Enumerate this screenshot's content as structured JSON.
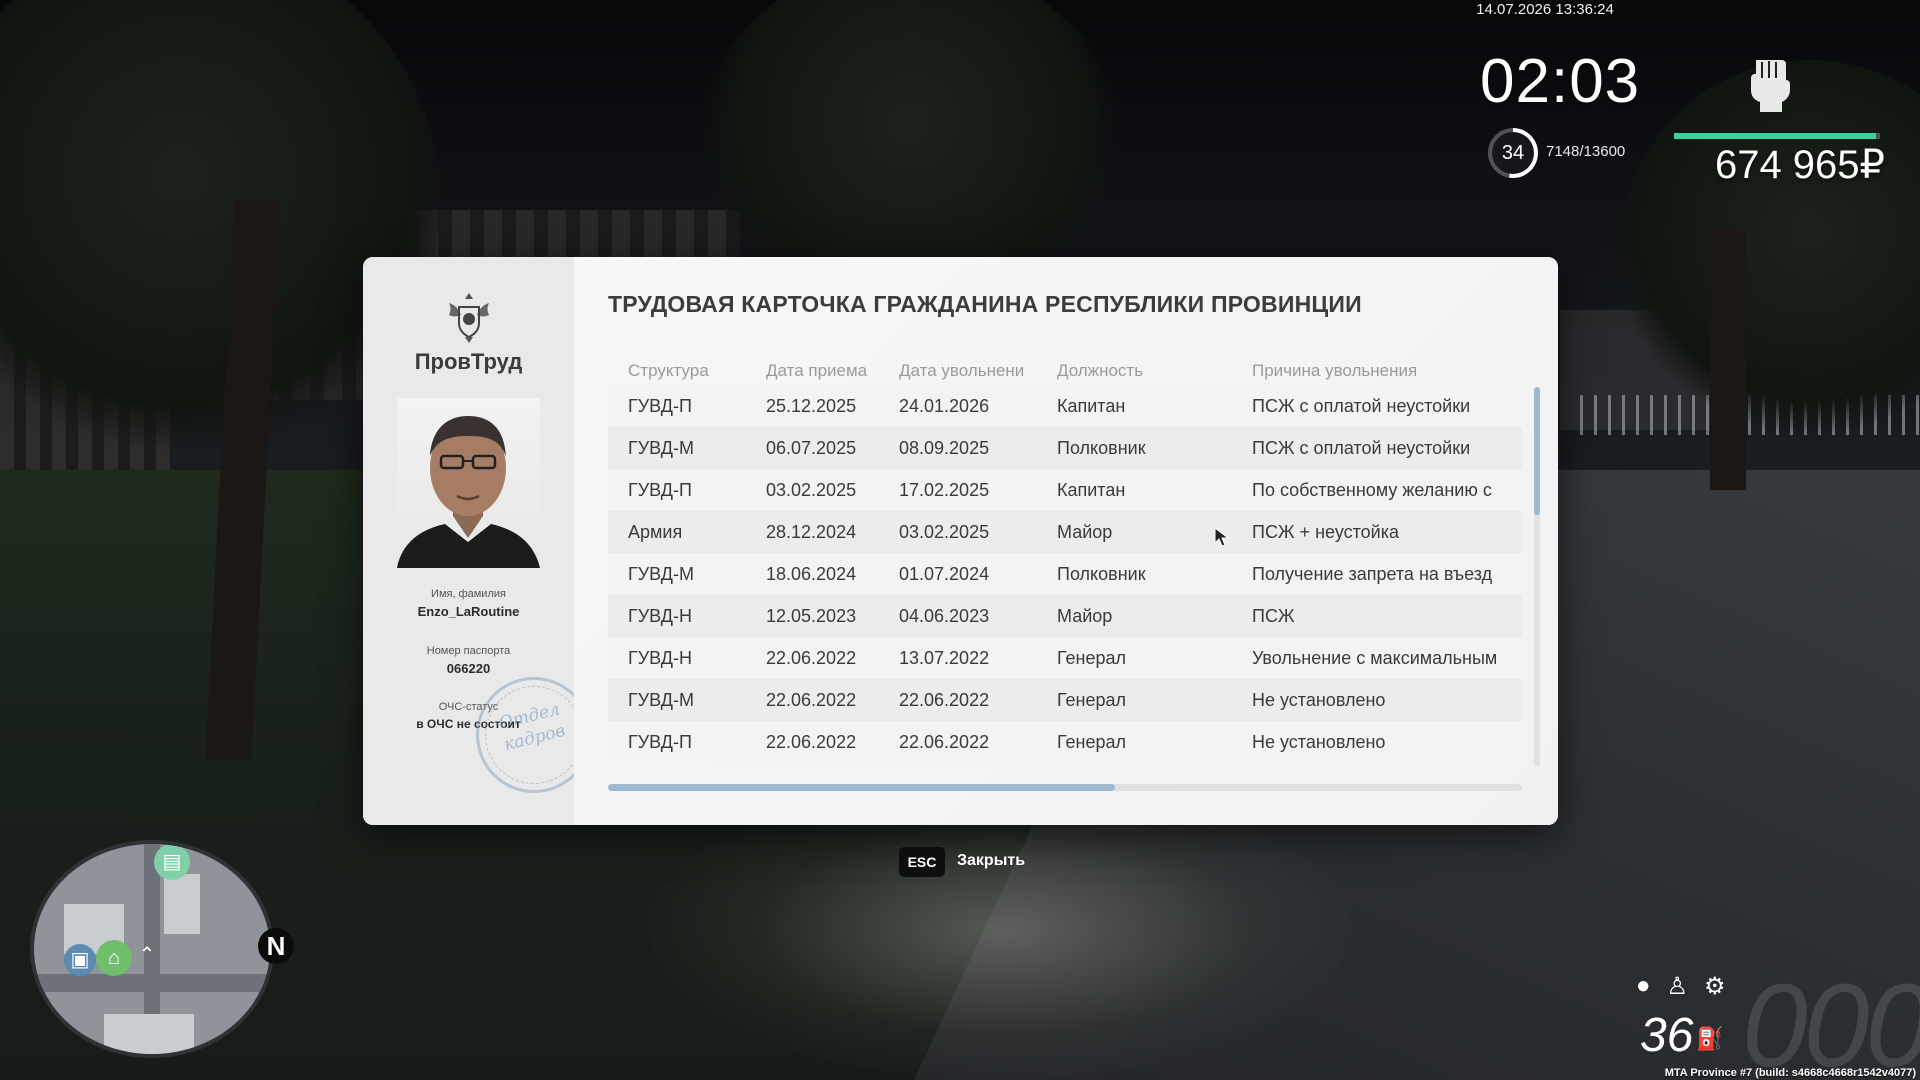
{
  "hud": {
    "datetime": "14.07.2026 13:36:24",
    "clock": "02:03",
    "level": "34",
    "level_progress": 0.525,
    "xp": "7148/13600",
    "money": "674 965₽",
    "health_fraction": 0.98,
    "health_color": "#38d39b"
  },
  "dialog": {
    "brand": "ПровТруд",
    "title": "ТРУДОВАЯ КАРТОЧКА ГРАЖДАНИНА РЕСПУБЛИКИ ПРОВИНЦИИ",
    "name_label": "Имя, фамилия",
    "name_value": "Enzo_LaRoutine",
    "passport_label": "Номер паспорта",
    "passport_value": "066220",
    "ochs_label": "ОЧС-статус",
    "ochs_value": "в ОЧС не состоит",
    "stamp_line1": "Отдел",
    "stamp_line2": "кадров",
    "columns": [
      "Структура",
      "Дата приема",
      "Дата увольнени",
      "Должность",
      "Причина увольнения"
    ],
    "rows": [
      [
        "ГУВД-П",
        "25.12.2025",
        "24.01.2026",
        "Капитан",
        "ПСЖ с оплатой неустойки"
      ],
      [
        "ГУВД-М",
        "06.07.2025",
        "08.09.2025",
        "Полковник",
        "ПСЖ с оплатой неустойки"
      ],
      [
        "ГУВД-П",
        "03.02.2025",
        "17.02.2025",
        "Капитан",
        "По собственному желанию с"
      ],
      [
        "Армия",
        "28.12.2024",
        "03.02.2025",
        "Майор",
        "ПСЖ + неустойка"
      ],
      [
        "ГУВД-М",
        "18.06.2024",
        "01.07.2024",
        "Полковник",
        "Получение запрета на въезд"
      ],
      [
        "ГУВД-Н",
        "12.05.2023",
        "04.06.2023",
        "Майор",
        "ПСЖ"
      ],
      [
        "ГУВД-Н",
        "22.06.2022",
        "13.07.2022",
        "Генерал",
        "Увольнение с максимальным"
      ],
      [
        "ГУВД-М",
        "22.06.2022",
        "22.06.2022",
        "Генерал",
        "Не установлено"
      ],
      [
        "ГУВД-П",
        "22.06.2022",
        "22.06.2022",
        "Генерал",
        "Не установлено"
      ]
    ],
    "accent_color": "#9ebad2"
  },
  "footer": {
    "key": "ESC",
    "close_label": "Закрыть"
  },
  "minimap": {
    "compass": "N"
  },
  "vehicle": {
    "speed": "36",
    "gear": "000"
  },
  "build_info": "MTA Province #7 (build: s4668c4668r1542v4077)"
}
